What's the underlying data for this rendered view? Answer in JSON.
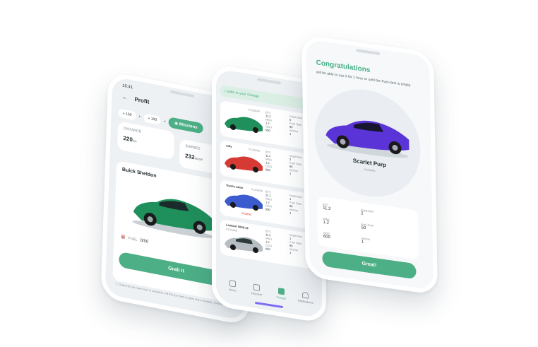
{
  "profile_screen": {
    "time": "16:41",
    "title": "Profit",
    "chip_1": "150",
    "chip_2": "100",
    "missions_label": "Missions",
    "distance_label": "DISTANCE",
    "distance_value": "220",
    "distance_unit": "km",
    "earned_label": "EARNED",
    "earned_value": "232",
    "earned_unit": "WASP",
    "car_name": "Buick Sheldon",
    "fuel_label": "FUEL",
    "fuel_value": "0/50",
    "grab_label": "Grab it",
    "note_text": "Grab this car now! Fuel is complete. Fill the fuel tank to grab more rewards. (24 km + 2 bars)"
  },
  "garage_screen": {
    "banner_text": "r adde to your Garage",
    "close_icon": "×",
    "items": [
      {
        "name": "",
        "id": "#1234Ab",
        "btc": "11.2",
        "inspection": "0",
        "miles": "1.2",
        "fuel": "90",
        "odo": "600",
        "interior": "1"
      },
      {
        "name": "rolly",
        "id": "#1234Ab",
        "btc": "11.2",
        "inspection": "2",
        "miles": "1.2",
        "fuel": "90",
        "odo": "600",
        "interior": "1"
      },
      {
        "name": "Toyota Jalon",
        "id": "#1234Ab",
        "btc": "11.1",
        "inspection": "1",
        "miles": "1.2",
        "fuel": "90",
        "odo": "600",
        "interior": "1",
        "badge": "#A2560"
      },
      {
        "name": "Lambert 0038-18",
        "id": "#1234Ab",
        "btc": "11.2",
        "inspection": "1",
        "miles": "1.2",
        "fuel": "90",
        "odo": "600",
        "interior": "1"
      }
    ],
    "labels": {
      "btc": "BTC",
      "inspection": "Inspection",
      "miles": "Miles",
      "fuel": "Fuel Tank",
      "odo": "ODO",
      "interior": "Interior"
    },
    "nav": [
      "Home",
      "Discover",
      "Garage",
      "Notifications"
    ]
  },
  "congrats_screen": {
    "title": "Congratulations",
    "subtitle": "will be able to use it for 1 hour or until the Fuel-tank is empty",
    "car_name": "Scarlet Purp",
    "car_id": "#1234Ab",
    "btc_label": "BTC",
    "btc_value": "11.2",
    "inspection_label": "Inspection",
    "inspection_value": "2",
    "miles_label": "Miles",
    "miles_value": "1.2",
    "fuel_label": "Fuel-Tank",
    "fuel_value": "50",
    "odo_label": "ODO",
    "odo_value": "600",
    "interior_label": "Interior",
    "interior_value": "1",
    "great_label": "Great!"
  },
  "colors": {
    "accent": "#4caf86",
    "purple": "#7b6cf6",
    "car_green": "#1f8f5b",
    "car_red": "#d63a35",
    "car_blue": "#3b5bcf",
    "car_purple": "#5a34d6"
  }
}
